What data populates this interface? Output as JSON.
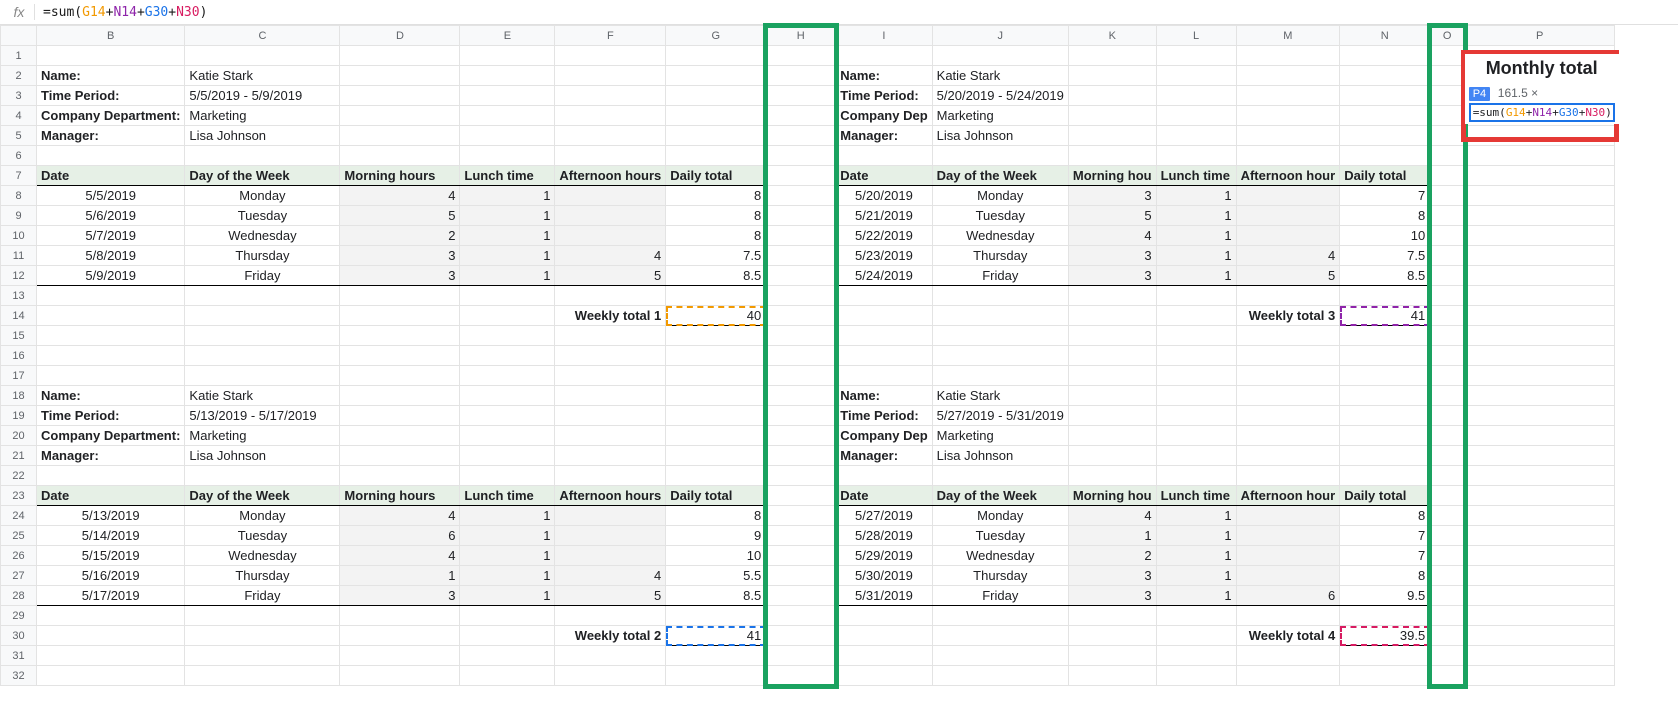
{
  "formula_bar": {
    "prefix": "=sum(",
    "ref1": "G14",
    "ref2": "N14",
    "ref3": "G30",
    "ref4": "N30",
    "suffix": ")"
  },
  "columns": [
    "B",
    "C",
    "D",
    "E",
    "F",
    "G",
    "H",
    "I",
    "J",
    "K",
    "L",
    "M",
    "N",
    "O",
    "P"
  ],
  "meta_labels": {
    "name": "Name:",
    "period": "Time Period:",
    "dept": "Company Department:",
    "dept_short": "Company Dep",
    "manager": "Manager:"
  },
  "table_headers": {
    "date": "Date",
    "dow": "Day of the Week",
    "morning": "Morning hours",
    "morning_short": "Morning hou",
    "lunch": "Lunch time",
    "afternoon": "Afternoon hours",
    "afternoon_short": "Afternoon hour",
    "daily": "Daily total"
  },
  "weekly_labels": {
    "w1": "Weekly total 1",
    "w2": "Weekly total 2",
    "w3": "Weekly total 3",
    "w4": "Weekly total 4"
  },
  "monthly": {
    "title": "Monthly total",
    "cellref": "P4",
    "preview_value": "161.5 ×"
  },
  "blocks": {
    "top_left": {
      "meta": {
        "name": "Katie Stark",
        "period": "5/5/2019 - 5/9/2019",
        "dept": "Marketing",
        "manager": "Lisa Johnson"
      },
      "rows": [
        {
          "date": "5/5/2019",
          "dow": "Monday",
          "morning": "4",
          "lunch": "1",
          "afternoon": "",
          "daily": "8"
        },
        {
          "date": "5/6/2019",
          "dow": "Tuesday",
          "morning": "5",
          "lunch": "1",
          "afternoon": "",
          "daily": "8"
        },
        {
          "date": "5/7/2019",
          "dow": "Wednesday",
          "morning": "2",
          "lunch": "1",
          "afternoon": "",
          "daily": "8"
        },
        {
          "date": "5/8/2019",
          "dow": "Thursday",
          "morning": "3",
          "lunch": "1",
          "afternoon": "4",
          "daily": "7.5"
        },
        {
          "date": "5/9/2019",
          "dow": "Friday",
          "morning": "3",
          "lunch": "1",
          "afternoon": "5",
          "daily": "8.5"
        }
      ],
      "weekly_total": "40"
    },
    "top_right": {
      "meta": {
        "name": "Katie Stark",
        "period": "5/20/2019 - 5/24/2019",
        "dept": "Marketing",
        "manager": "Lisa Johnson"
      },
      "rows": [
        {
          "date": "5/20/2019",
          "dow": "Monday",
          "morning": "3",
          "lunch": "1",
          "afternoon": "",
          "daily": "7"
        },
        {
          "date": "5/21/2019",
          "dow": "Tuesday",
          "morning": "5",
          "lunch": "1",
          "afternoon": "",
          "daily": "8"
        },
        {
          "date": "5/22/2019",
          "dow": "Wednesday",
          "morning": "4",
          "lunch": "1",
          "afternoon": "",
          "daily": "10"
        },
        {
          "date": "5/23/2019",
          "dow": "Thursday",
          "morning": "3",
          "lunch": "1",
          "afternoon": "4",
          "daily": "7.5"
        },
        {
          "date": "5/24/2019",
          "dow": "Friday",
          "morning": "3",
          "lunch": "1",
          "afternoon": "5",
          "daily": "8.5"
        }
      ],
      "weekly_total": "41"
    },
    "bottom_left": {
      "meta": {
        "name": "Katie Stark",
        "period": "5/13/2019 - 5/17/2019",
        "dept": "Marketing",
        "manager": "Lisa Johnson"
      },
      "rows": [
        {
          "date": "5/13/2019",
          "dow": "Monday",
          "morning": "4",
          "lunch": "1",
          "afternoon": "",
          "daily": "8"
        },
        {
          "date": "5/14/2019",
          "dow": "Tuesday",
          "morning": "6",
          "lunch": "1",
          "afternoon": "",
          "daily": "9"
        },
        {
          "date": "5/15/2019",
          "dow": "Wednesday",
          "morning": "4",
          "lunch": "1",
          "afternoon": "",
          "daily": "10"
        },
        {
          "date": "5/16/2019",
          "dow": "Thursday",
          "morning": "1",
          "lunch": "1",
          "afternoon": "4",
          "daily": "5.5"
        },
        {
          "date": "5/17/2019",
          "dow": "Friday",
          "morning": "3",
          "lunch": "1",
          "afternoon": "5",
          "daily": "8.5"
        }
      ],
      "weekly_total": "41"
    },
    "bottom_right": {
      "meta": {
        "name": "Katie Stark",
        "period": "5/27/2019 - 5/31/2019",
        "dept": "Marketing",
        "manager": "Lisa Johnson"
      },
      "rows": [
        {
          "date": "5/27/2019",
          "dow": "Monday",
          "morning": "4",
          "lunch": "1",
          "afternoon": "",
          "daily": "8"
        },
        {
          "date": "5/28/2019",
          "dow": "Tuesday",
          "morning": "1",
          "lunch": "1",
          "afternoon": "",
          "daily": "7"
        },
        {
          "date": "5/29/2019",
          "dow": "Wednesday",
          "morning": "2",
          "lunch": "1",
          "afternoon": "",
          "daily": "7"
        },
        {
          "date": "5/30/2019",
          "dow": "Thursday",
          "morning": "3",
          "lunch": "1",
          "afternoon": "",
          "daily": "8"
        },
        {
          "date": "5/31/2019",
          "dow": "Friday",
          "morning": "3",
          "lunch": "1",
          "afternoon": "6",
          "daily": "9.5"
        }
      ],
      "weekly_total": "39.5"
    }
  },
  "chart_data": {
    "type": "table",
    "title": "Weekly timesheets aggregated into a monthly total",
    "weeks": [
      {
        "label": "Weekly total 1",
        "period": "5/5/2019 - 5/9/2019",
        "hours": 40
      },
      {
        "label": "Weekly total 2",
        "period": "5/13/2019 - 5/17/2019",
        "hours": 41
      },
      {
        "label": "Weekly total 3",
        "period": "5/20/2019 - 5/24/2019",
        "hours": 41
      },
      {
        "label": "Weekly total 4",
        "period": "5/27/2019 - 5/31/2019",
        "hours": 39.5
      }
    ],
    "monthly_total": 161.5
  }
}
